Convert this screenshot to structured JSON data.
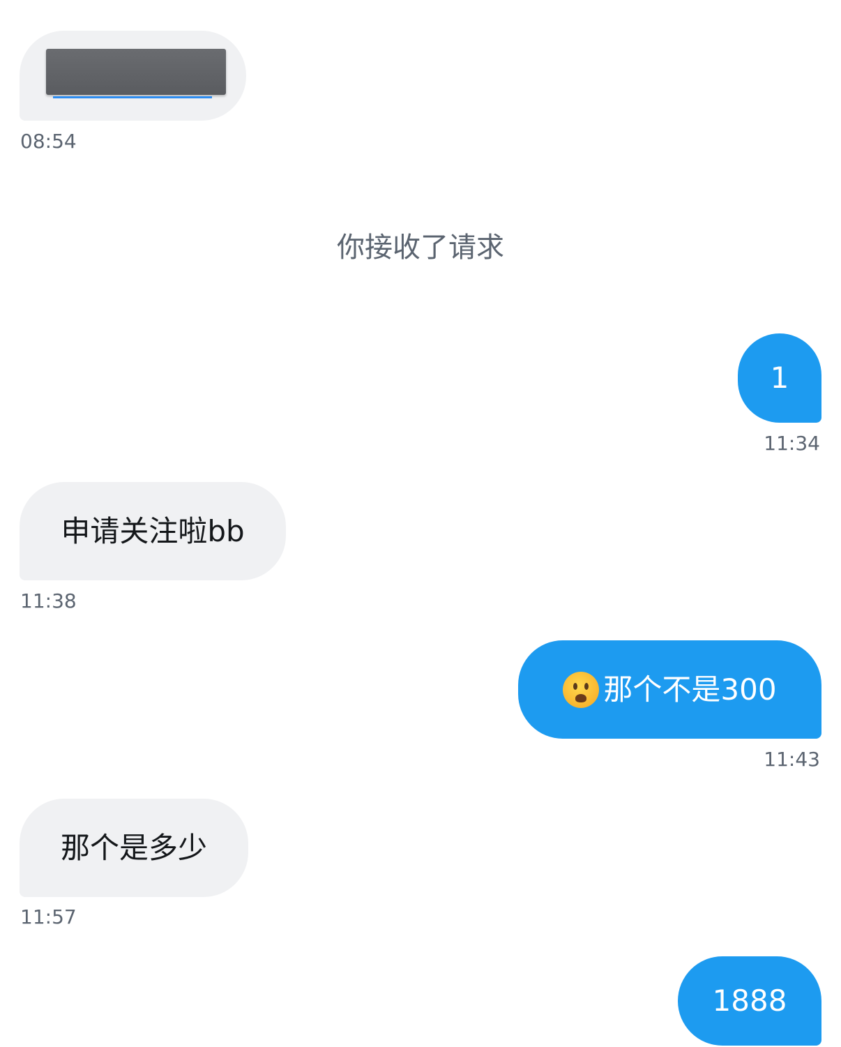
{
  "messages": [
    {
      "direction": "in",
      "kind": "media",
      "time": "08:54"
    },
    {
      "direction": "system",
      "text": "你接收了请求"
    },
    {
      "direction": "out",
      "text": "1",
      "time": "11:34"
    },
    {
      "direction": "in",
      "text": "申请关注啦bb",
      "time": "11:38"
    },
    {
      "direction": "out",
      "emoji": "worried-face-icon",
      "text": "那个不是300",
      "time": "11:43"
    },
    {
      "direction": "in",
      "text": "那个是多少",
      "time": "11:57"
    },
    {
      "direction": "out",
      "text": "1888"
    }
  ],
  "colors": {
    "incoming_bubble": "#f0f1f3",
    "outgoing_bubble": "#1d9bf0",
    "timestamp": "#5b6470"
  }
}
